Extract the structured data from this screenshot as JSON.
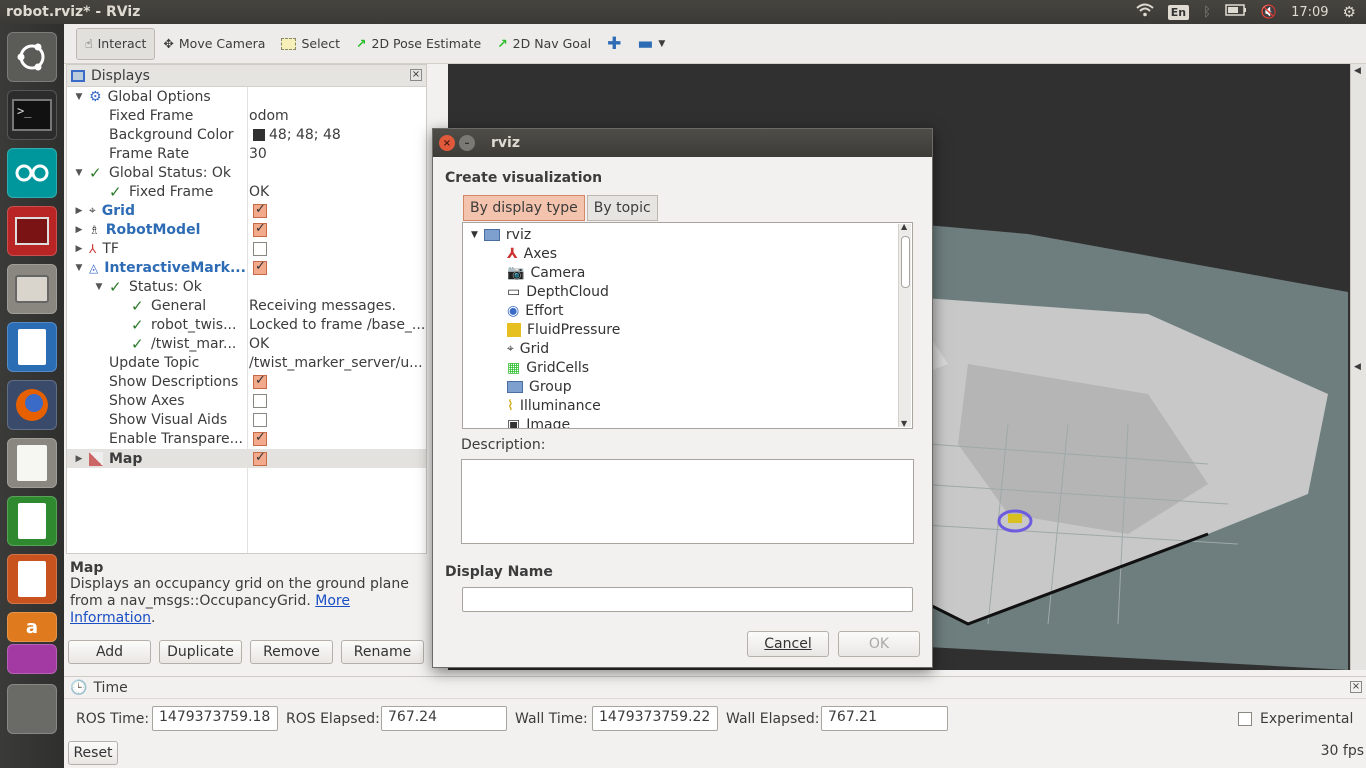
{
  "window": {
    "title": "robot.rviz* - RViz"
  },
  "tray": {
    "keyboard": "En",
    "clock": "17:09"
  },
  "launcher": {
    "apps": [
      "ubuntu-dash",
      "terminal",
      "arduino",
      "system-monitor",
      "file-manager",
      "libreoffice-writer",
      "firefox",
      "text-editor",
      "libreoffice-calc",
      "libreoffice-impress",
      "amazon",
      "software-center",
      "workspace-switcher"
    ]
  },
  "toolbar": {
    "interact": "Interact",
    "move_camera": "Move Camera",
    "select": "Select",
    "pose_estimate": "2D Pose Estimate",
    "nav_goal": "2D Nav Goal"
  },
  "displays": {
    "title": "Displays",
    "rows": [
      {
        "name": "Global Options",
        "value": ""
      },
      {
        "name": "Fixed Frame",
        "value": "odom"
      },
      {
        "name": "Background Color",
        "value": "48; 48; 48"
      },
      {
        "name": "Frame Rate",
        "value": "30"
      },
      {
        "name": "Global Status: Ok",
        "value": ""
      },
      {
        "name": "Fixed Frame",
        "value": "OK"
      },
      {
        "name": "Grid",
        "value": ""
      },
      {
        "name": "RobotModel",
        "value": ""
      },
      {
        "name": "TF",
        "value": ""
      },
      {
        "name": "InteractiveMark...",
        "value": ""
      },
      {
        "name": "Status: Ok",
        "value": ""
      },
      {
        "name": "General",
        "value": "Receiving messages."
      },
      {
        "name": "robot_twis...",
        "value": "Locked to frame /base_..."
      },
      {
        "name": "/twist_mar...",
        "value": "OK"
      },
      {
        "name": "Update Topic",
        "value": "/twist_marker_server/u..."
      },
      {
        "name": "Show Descriptions",
        "value": ""
      },
      {
        "name": "Show Axes",
        "value": ""
      },
      {
        "name": "Show Visual Aids",
        "value": ""
      },
      {
        "name": "Enable Transpare...",
        "value": ""
      },
      {
        "name": "Map",
        "value": ""
      }
    ],
    "checks": {
      "grid": true,
      "robotmodel": true,
      "tf": false,
      "interactive": true,
      "show_descriptions": true,
      "show_axes": false,
      "show_visual_aids": false,
      "enable_transparency": true,
      "map": true
    }
  },
  "description": {
    "heading": "Map",
    "text": "Displays an occupancy grid on the ground plane from a nav_msgs::OccupancyGrid.",
    "link": "More Information",
    "end": "."
  },
  "panel_buttons": {
    "add": "Add",
    "duplicate": "Duplicate",
    "remove": "Remove",
    "rename": "Rename"
  },
  "time": {
    "title": "Time",
    "ros_time_label": "ROS Time:",
    "ros_time": "1479373759.18",
    "ros_elapsed_label": "ROS Elapsed:",
    "ros_elapsed": "767.24",
    "wall_time_label": "Wall Time:",
    "wall_time": "1479373759.22",
    "wall_elapsed_label": "Wall Elapsed:",
    "wall_elapsed": "767.21",
    "experimental": "Experimental",
    "reset": "Reset",
    "fps": "30 fps"
  },
  "dialog": {
    "title": "rviz",
    "heading": "Create visualization",
    "tab_display_type": "By display type",
    "tab_topic": "By topic",
    "root": "rviz",
    "items": [
      "Axes",
      "Camera",
      "DepthCloud",
      "Effort",
      "FluidPressure",
      "Grid",
      "GridCells",
      "Group",
      "Illuminance",
      "Image"
    ],
    "description_label": "Description:",
    "display_name_label": "Display Name",
    "cancel": "Cancel",
    "ok": "OK"
  },
  "colors": {
    "background": "#303030",
    "map_free": "#c8c8c8",
    "map_unknown": "#6e7e7e",
    "accent": "#f3a98c"
  }
}
